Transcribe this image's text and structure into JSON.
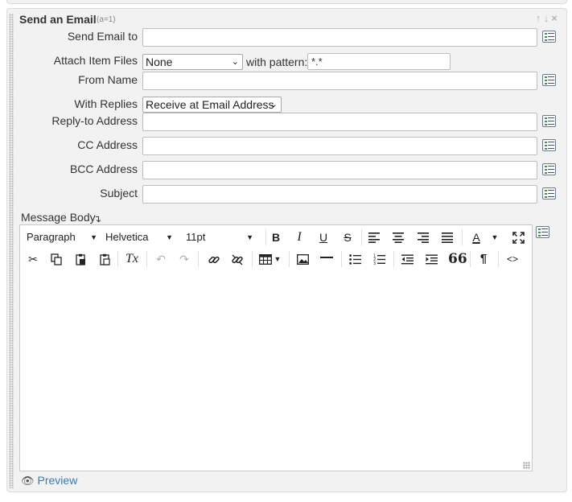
{
  "panel": {
    "title": "Send an Email",
    "subtitle": "(a=1)",
    "actions": {
      "move_up": "↑",
      "move_down": "↓",
      "close": "×"
    }
  },
  "fields": {
    "send_to": {
      "label": "Send Email to",
      "value": ""
    },
    "attach": {
      "label": "Attach Item Files",
      "selected": "None",
      "pattern_label": "with pattern:",
      "pattern_value": "*.*"
    },
    "from_name": {
      "label": "From Name",
      "value": ""
    },
    "replies": {
      "label": "With Replies",
      "selected": "Receive at Email Address"
    },
    "reply_to": {
      "label": "Reply-to Address",
      "value": ""
    },
    "cc": {
      "label": "CC Address",
      "value": ""
    },
    "bcc": {
      "label": "BCC Address",
      "value": ""
    },
    "subject": {
      "label": "Subject",
      "value": ""
    }
  },
  "message_body": {
    "label": "Message Body",
    "arrow": "↴",
    "toolbar": {
      "block_format": "Paragraph",
      "font_family": "Helvetica",
      "font_size": "11pt",
      "bold": "B",
      "italic": "I",
      "underline": "U",
      "strike": "S",
      "text_color": "A",
      "blockquote": "66",
      "pilcrow": "¶",
      "code": "<>",
      "clear_format": "Tx"
    },
    "content": ""
  },
  "preview": {
    "label": "Preview"
  },
  "colors": {
    "link": "#3a78b8",
    "panel_bg": "#f2f2f2",
    "border": "#dcdcdc"
  }
}
